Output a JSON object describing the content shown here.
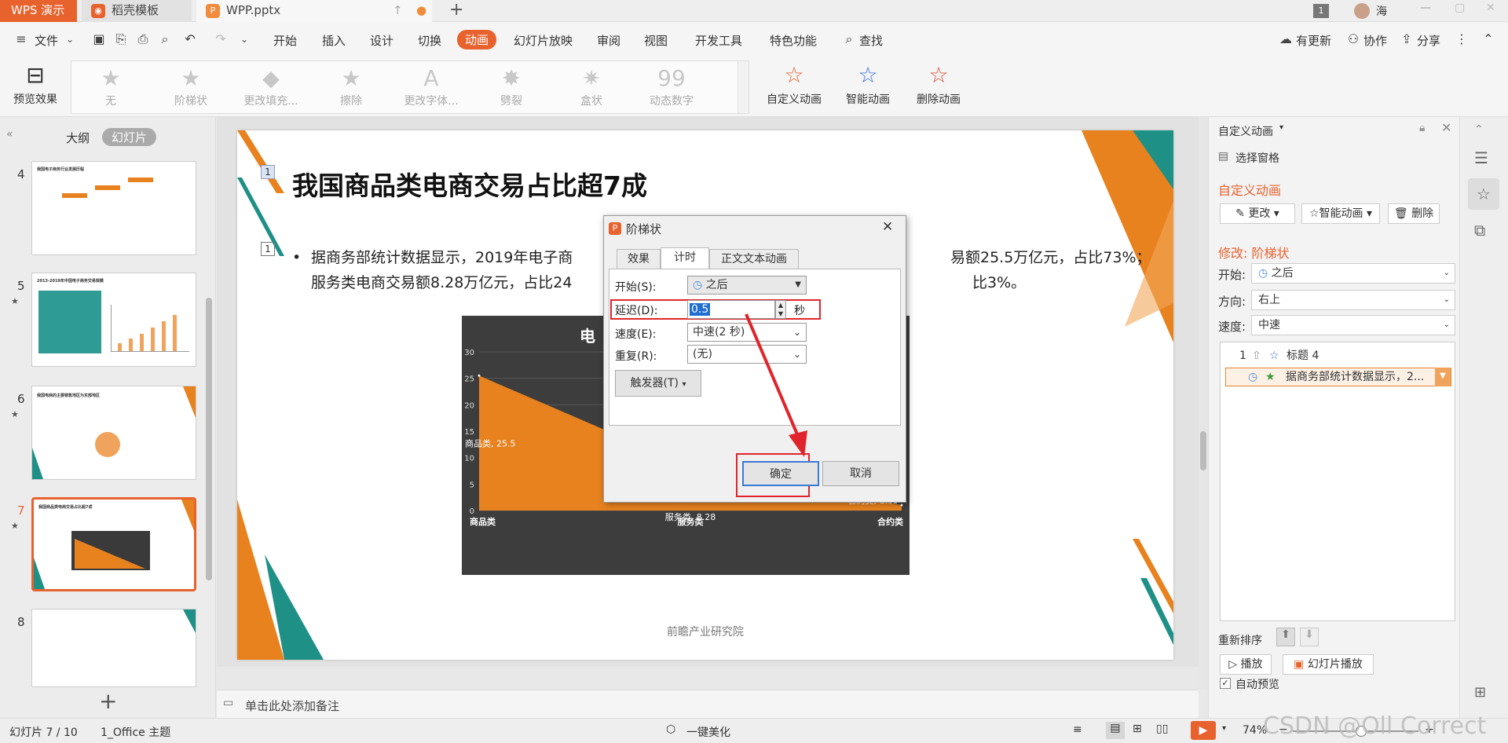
{
  "titlebar": {
    "app_tab": "WPS 演示",
    "template_tab": "稻壳模板",
    "file_tab": "WPP.pptx",
    "window_badge": "1",
    "user_name": "海"
  },
  "menu": {
    "file": "文件",
    "items": [
      "开始",
      "插入",
      "设计",
      "切换",
      "动画",
      "幻灯片放映",
      "审阅",
      "视图",
      "开发工具",
      "特色功能"
    ],
    "active": "动画",
    "search": "查找",
    "update": "有更新",
    "collab": "协作",
    "share": "分享"
  },
  "ribbon": {
    "preview": "预览效果",
    "gallery": [
      "无",
      "阶梯状",
      "更改填充...",
      "擦除",
      "更改字体...",
      "劈裂",
      "盒状",
      "动态数字"
    ],
    "custom": "自定义动画",
    "smart": "智能动画",
    "delete": "删除动画"
  },
  "left_panel": {
    "tab_outline": "大纲",
    "tab_slides": "幻灯片",
    "slide_numbers": [
      "4",
      "5",
      "6",
      "7",
      "8"
    ],
    "thumb_titles": [
      "我国电子商务行业发展历程",
      "2013-2019年中国电子商务交易规模",
      "我国电商的主要销售地区为东部地区",
      "我国商品类电商交易占比超7成",
      ""
    ]
  },
  "slide": {
    "title_marker": "1",
    "title": "我国商品类电商交易占比超7成",
    "bullet_marker": "1",
    "bullet_line1_a": "据商务部统计数据显示，2019年电子商",
    "bullet_line1_b": "易额25.5万亿元，占比73%；",
    "bullet_line2_a": "服务类电商交易额8.28万亿元，占比24",
    "bullet_line2_b": "比3%。",
    "chart_title_frag": "电",
    "source": "前瞻产业研究院"
  },
  "chart_data": {
    "type": "area",
    "categories": [
      "商品类",
      "服务类",
      "合约类"
    ],
    "values": [
      25.5,
      8.28,
      1.03
    ],
    "data_labels": [
      "商品类, 25.5",
      "服务类, 8.28",
      "合约类, 1.03"
    ],
    "yticks": [
      "0",
      "5",
      "10",
      "15",
      "20",
      "25",
      "30"
    ],
    "ylim": [
      0,
      30
    ],
    "color": "#e8821e"
  },
  "dialog": {
    "title": "阶梯状",
    "tabs": [
      "效果",
      "计时",
      "正文文本动画"
    ],
    "active_tab": "计时",
    "start_label": "开始(S):",
    "start_value": "之后",
    "delay_label": "延迟(D):",
    "delay_value": "0.5",
    "delay_unit": "秒",
    "speed_label": "速度(E):",
    "speed_value": "中速(2 秒)",
    "repeat_label": "重复(R):",
    "repeat_value": "(无)",
    "trigger": "触发器(T)",
    "ok": "确定",
    "cancel": "取消"
  },
  "right_panel": {
    "header": "自定义动画",
    "select_pane": "选择窗格",
    "section": "自定义动画",
    "change": "更改",
    "smart": "智能动画",
    "delete": "删除",
    "modify": "修改: 阶梯状",
    "start_label": "开始:",
    "start_value": "之后",
    "dir_label": "方向:",
    "dir_value": "右上",
    "speed_label": "速度:",
    "speed_value": "中速",
    "list": [
      {
        "num": "1",
        "text": "标题 4"
      },
      {
        "num": "",
        "text": "据商务部统计数据显示，2..."
      }
    ],
    "reorder": "重新排序",
    "play": "播放",
    "slideshow": "幻灯片播放",
    "autopreview": "自动预览"
  },
  "notes": {
    "placeholder": "单击此处添加备注"
  },
  "status": {
    "slide_info": "幻灯片 7 / 10",
    "theme": "1_Office 主题",
    "beautify": "一键美化",
    "zoom": "74%",
    "watermark": "CSDN @Oll Correct"
  }
}
